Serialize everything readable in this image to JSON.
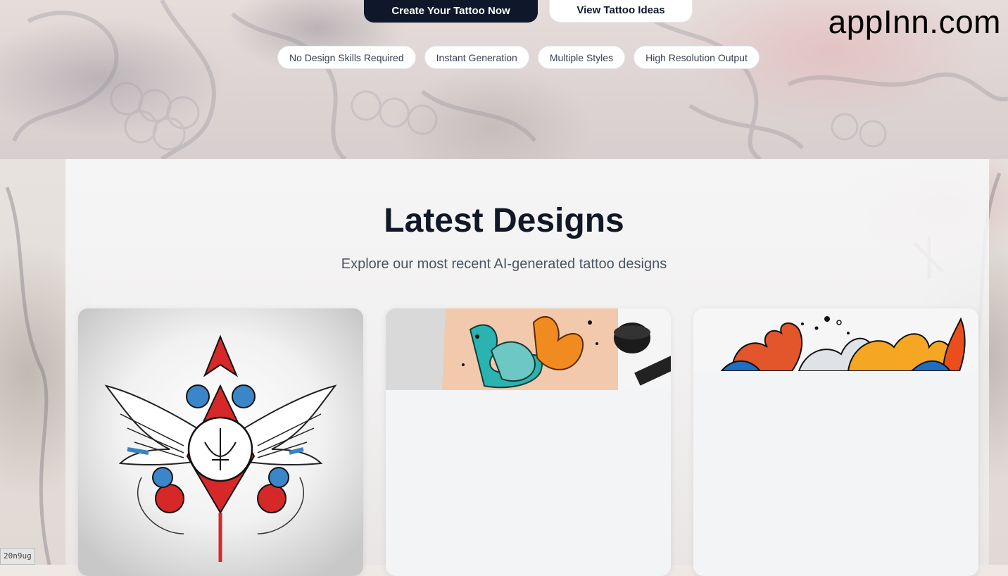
{
  "hero": {
    "primary_button": "Create Your Tattoo Now",
    "secondary_button": "View Tattoo Ideas",
    "features": [
      "No Design Skills Required",
      "Instant Generation",
      "Multiple Styles",
      "High Resolution Output"
    ]
  },
  "watermark": "appInn.com",
  "latest": {
    "title": "Latest Designs",
    "subtitle": "Explore our most recent AI-generated tattoo designs"
  },
  "debug_tag": "20n9ug",
  "colors": {
    "primary": "#0f172a",
    "heading": "#111827",
    "muted": "#4b5563"
  }
}
